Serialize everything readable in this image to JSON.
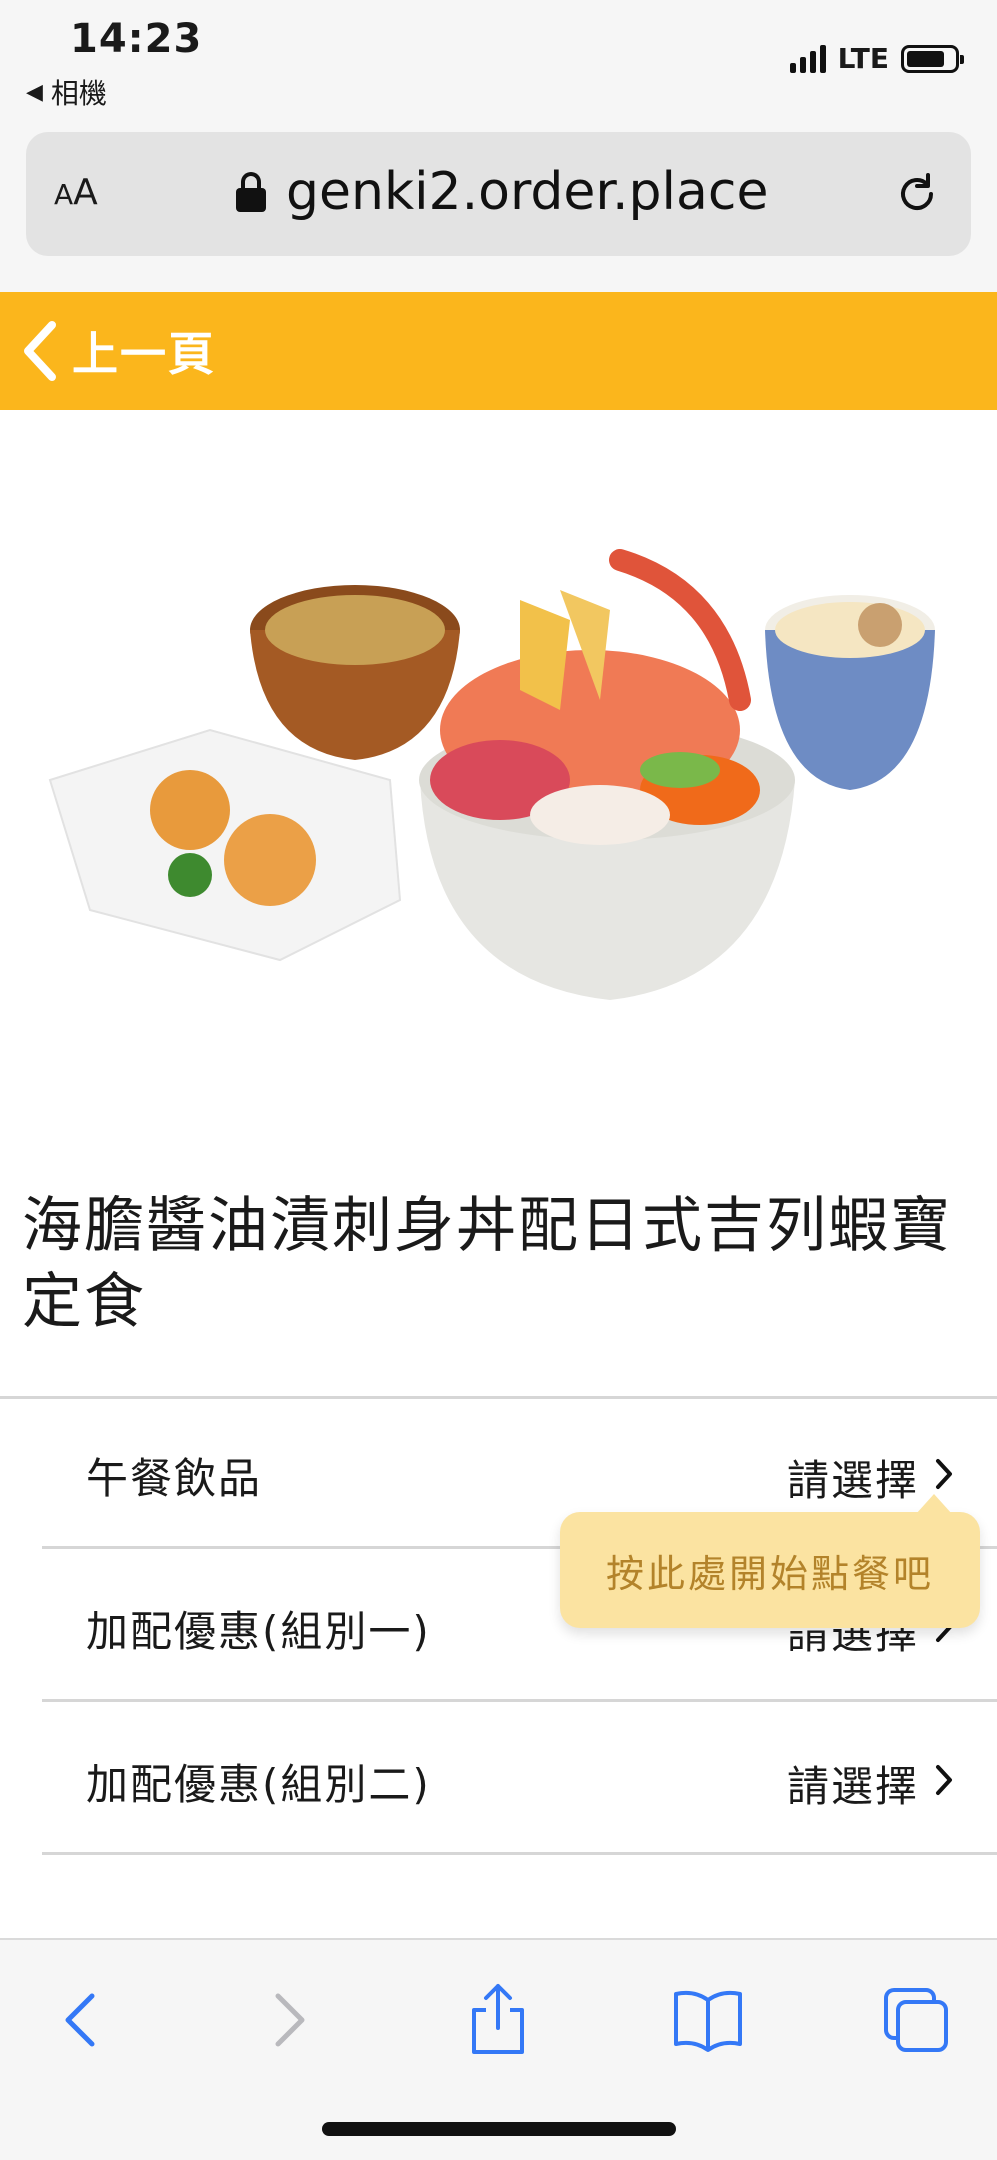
{
  "status_bar": {
    "time": "14:23",
    "back_app": "相機",
    "network": "LTE",
    "battery_level": 0.8
  },
  "browser": {
    "text_size_label_small": "A",
    "text_size_label_large": "A",
    "url": "genki2.order.place",
    "icons": [
      "lock-icon",
      "reload-icon"
    ]
  },
  "header": {
    "back_label": "上一頁",
    "background_color": "#fbb61c"
  },
  "product": {
    "title": "海膽醬油漬刺身丼配日式吉列蝦寶定食"
  },
  "options": [
    {
      "label": "午餐飲品",
      "action": "請選擇"
    },
    {
      "label": "加配優惠(組別一)",
      "action": "請選擇"
    },
    {
      "label": "加配優惠(組別二)",
      "action": "請選擇"
    }
  ],
  "tooltip": {
    "text": "按此處開始點餐吧"
  },
  "toolbar": {
    "icons": [
      "back-icon",
      "forward-icon",
      "share-icon",
      "bookmarks-icon",
      "tabs-icon"
    ]
  }
}
